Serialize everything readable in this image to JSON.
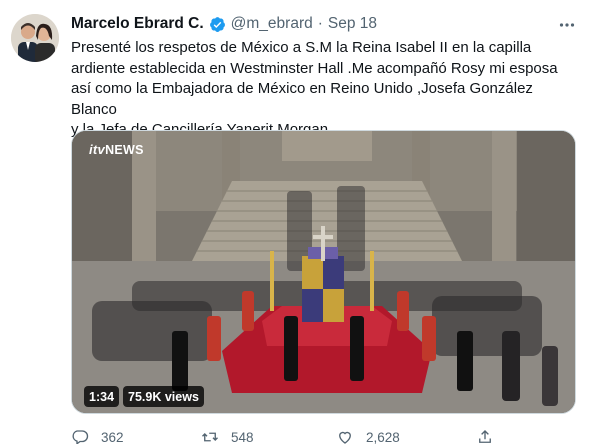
{
  "tweet": {
    "author_name": "Marcelo Ebrard C.",
    "handle": "@m_ebrard",
    "separator": "·",
    "date": "Sep 18",
    "text": "Presenté los respetos de México a S.M la Reina Isabel II en la capilla\nardiente establecida en Westminster Hall .Me acompañó Rosy mi esposa\nasí como la Embajadora de México en Reino Unido ,Josefa González Blanco\ny la Jefa de Cancillería Yanerit Morgan."
  },
  "media": {
    "watermark_prefix": "itv",
    "watermark_suffix": "NEWS",
    "duration": "1:34",
    "views": "75.9K views"
  },
  "actions": {
    "replies": "362",
    "retweets": "548",
    "likes": "2,628"
  },
  "icons": {
    "verified": "verified-badge-icon",
    "more": "more-options-icon",
    "reply": "reply-icon",
    "retweet": "retweet-icon",
    "like": "heart-icon",
    "share": "share-icon"
  },
  "colors": {
    "verified_blue": "#1d9bf0",
    "secondary_text": "#536471",
    "carpet_red": "#b2182b"
  }
}
